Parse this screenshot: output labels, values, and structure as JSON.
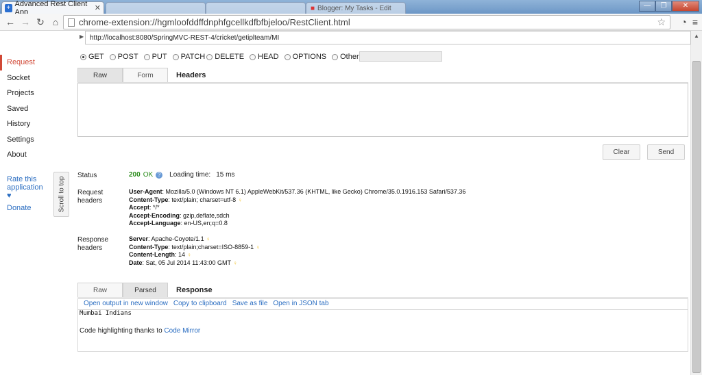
{
  "browser": {
    "active_tab_title": "Advanced Rest Client App",
    "bg_tabs": [
      "",
      "",
      "",
      "Blogger: My Tasks - Edit"
    ],
    "address": "chrome-extension://hgmloofddffdnphfgcellkdfbfbjeloo/RestClient.html"
  },
  "sidebar": {
    "items": [
      "Request",
      "Socket",
      "Projects",
      "Saved",
      "History",
      "Settings",
      "About"
    ],
    "rate": "Rate this application ♥",
    "donate": "Donate",
    "scroll_top": "Scroll to top"
  },
  "request": {
    "url": "http://localhost:8080/SpringMVC-REST-4/cricket/getiplteam/MI",
    "methods": [
      "GET",
      "POST",
      "PUT",
      "PATCH",
      "DELETE",
      "HEAD",
      "OPTIONS",
      "Other"
    ],
    "selected_method": "GET",
    "tabs": [
      "Raw",
      "Form"
    ],
    "tabs_title": "Headers",
    "clear_label": "Clear",
    "send_label": "Send"
  },
  "result": {
    "status_label": "Status",
    "status_code": "200",
    "status_text": "OK",
    "loading_label": "Loading time:",
    "loading_value": "15 ms",
    "request_headers_label": "Request headers",
    "request_headers": [
      {
        "name": "User-Agent",
        "value": "Mozilla/5.0 (Windows NT 6.1) AppleWebKit/537.36 (KHTML, like Gecko) Chrome/35.0.1916.153 Safari/537.36"
      },
      {
        "name": "Content-Type",
        "value": "text/plain; charset=utf-8"
      },
      {
        "name": "Accept",
        "value": "*/*"
      },
      {
        "name": "Accept-Encoding",
        "value": "gzip,deflate,sdch"
      },
      {
        "name": "Accept-Language",
        "value": "en-US,en;q=0.8"
      }
    ],
    "response_headers_label": "Response headers",
    "response_headers": [
      {
        "name": "Server",
        "value": "Apache-Coyote/1.1"
      },
      {
        "name": "Content-Type",
        "value": "text/plain;charset=ISO-8859-1"
      },
      {
        "name": "Content-Length",
        "value": "14"
      },
      {
        "name": "Date",
        "value": "Sat, 05 Jul 2014 11:43:00 GMT"
      }
    ]
  },
  "response": {
    "tabs": [
      "Raw",
      "Parsed"
    ],
    "tabs_title": "Response",
    "actions": [
      "Open output in new window",
      "Copy to clipboard",
      "Save as file",
      "Open in JSON tab"
    ],
    "body": "Mumbai Indians",
    "credit_prefix": "Code highlighting thanks to ",
    "credit_link": "Code Mirror"
  }
}
